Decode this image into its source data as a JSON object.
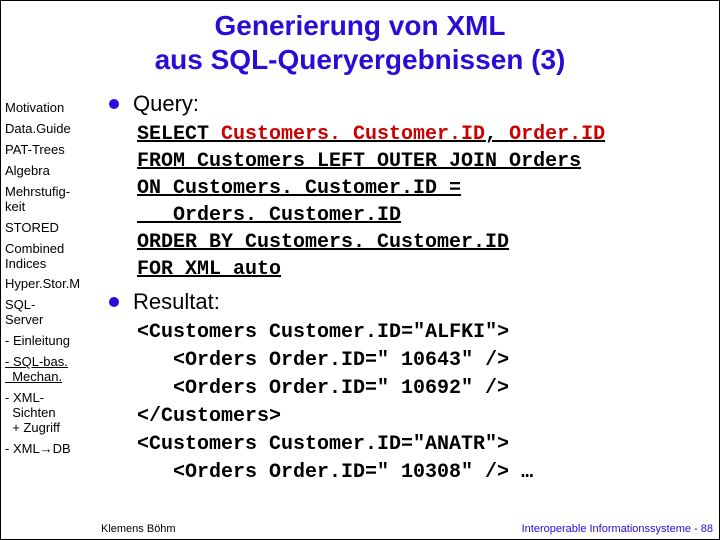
{
  "title_line1": "Generierung von XML",
  "title_line2": "aus SQL-Queryergebnissen (3)",
  "sidebar": {
    "items": [
      {
        "label": "Motivation",
        "active": false
      },
      {
        "label": "Data.Guide",
        "active": false
      },
      {
        "label": "PAT-Trees",
        "active": false
      },
      {
        "label": "Algebra",
        "active": false
      },
      {
        "label": "Mehrstufig-\nkeit",
        "active": false
      },
      {
        "label": "STORED",
        "active": false
      },
      {
        "label": "Combined\nIndices",
        "active": false
      },
      {
        "label": "Hyper.Stor.M",
        "active": false
      },
      {
        "label": "SQL-\nServer",
        "active": false
      },
      {
        "label": "- Einleitung",
        "active": false
      },
      {
        "label": "- SQL-bas.\n  Mechan.",
        "active": true
      },
      {
        "label": "- XML-\n  Sichten\n  + Zugriff",
        "active": false
      },
      {
        "label": "- XML→DB",
        "active": false
      }
    ]
  },
  "bullet1": "Query:",
  "query": {
    "l1a": "SELECT ",
    "l1b": "Customers. Customer.ID",
    "l1c": ", ",
    "l1d": "Order.ID",
    "l2": "FROM Customers LEFT OUTER JOIN Orders",
    "l3": "ON Customers. Customer.ID =",
    "l4": "   Orders. Customer.ID",
    "l5": "ORDER BY Customers. Customer.ID",
    "l6": "FOR XML auto"
  },
  "bullet2": "Resultat:",
  "result": {
    "l1a": "<Customers ",
    "l1b": "Customer.ID",
    "l1c": "=\"ALFKI\">",
    "l2a": "   <Orders ",
    "l2b": "Order.ID",
    "l2c": "=\" 10643\" />",
    "l3": "   <Orders Order.ID=\" 10692\" />",
    "l4": "</Customers>",
    "l5": "<Customers Customer.ID=\"ANATR\">",
    "l6": "   <Orders Order.ID=\" 10308\" /> …"
  },
  "footer": {
    "left": "Klemens Böhm",
    "right": "Interoperable Informationssysteme - 88"
  }
}
